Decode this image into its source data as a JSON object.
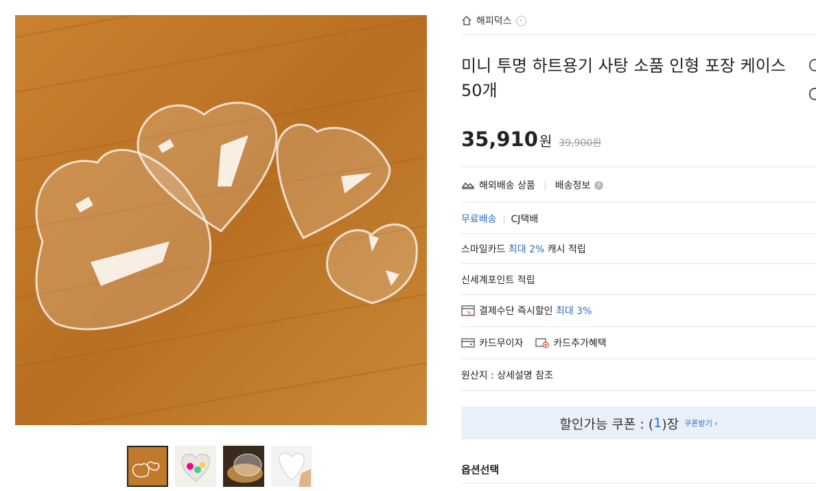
{
  "gallery": {
    "thumbnails": [
      {
        "alt": "thumb-1"
      },
      {
        "alt": "thumb-2"
      },
      {
        "alt": "thumb-3"
      },
      {
        "alt": "thumb-4"
      }
    ]
  },
  "product": {
    "brand": "해피덕스",
    "title": "미니 투명 하트용기 사탕 소품 인형 포장 케이스 50개",
    "price": "35,910",
    "currency": "원",
    "original_price": "39,900원"
  },
  "shipping": {
    "overseas": "해외배송 상품",
    "info": "배송정보",
    "free": "무료배송",
    "carrier": "CJ택배"
  },
  "benefits": {
    "smile_prefix": "스마일카드",
    "smile_rate": "최대 2%",
    "smile_suffix": "캐시 적립",
    "ssg": "신세계포인트 적립",
    "pay_prefix": "결제수단 즉시할인",
    "pay_rate": "최대 3%",
    "installment": "카드무이자",
    "card_benefit": "카드추가혜택"
  },
  "origin": "원산지 : 상세설명 참조",
  "coupon": {
    "label": "할인가능 쿠폰 : (",
    "count": "1",
    "suffix": ")장",
    "cta": "쿠폰받기 ›"
  },
  "options": {
    "title": "옵션선택"
  }
}
